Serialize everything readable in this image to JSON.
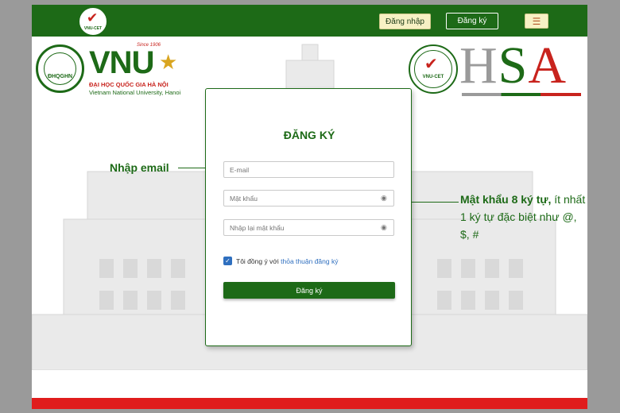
{
  "header": {
    "login_label": "Đăng nhập",
    "register_label": "Đăng ký",
    "menu_icon": "hamburger-icon",
    "small_logo_text": "VNU-CET"
  },
  "brand": {
    "vnu_seal_text": "ĐHQGHN",
    "vnu_wordmark": "VNU",
    "vnu_since": "Since 1906",
    "vnu_name_vi": "ĐẠI HỌC QUỐC GIA HÀ NỘI",
    "vnu_name_en": "Vietnam National University, Hanoi",
    "cet_seal_text": "VNU-CET",
    "hsa_h": "H",
    "hsa_s": "S",
    "hsa_a": "A"
  },
  "form": {
    "title": "ĐĂNG KÝ",
    "email_placeholder": "E-mail",
    "password_placeholder": "Mật khẩu",
    "confirm_placeholder": "Nhập lại mật khẩu",
    "agree_text": "Tôi đồng ý với ",
    "agree_link": "thỏa thuận đăng ký",
    "agree_checked": true,
    "submit_label": "Đăng ký"
  },
  "annotations": {
    "email_note": "Nhập email",
    "password_note_bold": "Mật khẩu 8 ký tự,",
    "password_note_rest": " ít nhất 1 ký tự đặc biệt như @, $, #"
  },
  "colors": {
    "brand_green": "#1d6a17",
    "accent_red": "#c8231d",
    "footer_red": "#e01c1c",
    "button_cream": "#f7f1c4"
  }
}
